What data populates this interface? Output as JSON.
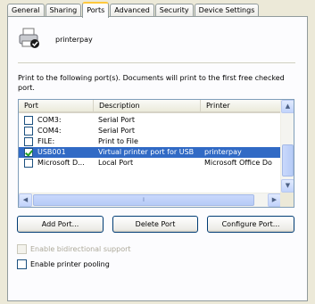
{
  "tabs": [
    {
      "label": "General",
      "active": false
    },
    {
      "label": "Sharing",
      "active": false
    },
    {
      "label": "Ports",
      "active": true
    },
    {
      "label": "Advanced",
      "active": false
    },
    {
      "label": "Security",
      "active": false
    },
    {
      "label": "Device Settings",
      "active": false
    }
  ],
  "printer": {
    "name": "printerpay"
  },
  "description": "Print to the following port(s). Documents will print to the first free checked port.",
  "ports": {
    "columns": [
      "Port",
      "Description",
      "Printer"
    ],
    "rows": [
      {
        "port": "COM3:",
        "description": "Serial Port",
        "printer": "",
        "checked": false,
        "selected": false
      },
      {
        "port": "COM4:",
        "description": "Serial Port",
        "printer": "",
        "checked": false,
        "selected": false
      },
      {
        "port": "FILE:",
        "description": "Print to File",
        "printer": "",
        "checked": false,
        "selected": false
      },
      {
        "port": "USB001",
        "description": "Virtual printer port for USB",
        "printer": "printerpay",
        "checked": true,
        "selected": true
      },
      {
        "port": "Microsoft D...",
        "description": "Local Port",
        "printer": "Microsoft Office Do",
        "checked": false,
        "selected": false
      }
    ]
  },
  "buttons": {
    "add_port": "Add Port...",
    "delete_port": "Delete Port",
    "configure_port": "Configure Port..."
  },
  "options": {
    "bidirectional": {
      "label": "Enable bidirectional support",
      "checked": false,
      "enabled": false
    },
    "pooling": {
      "label": "Enable printer pooling",
      "checked": false,
      "enabled": true
    }
  },
  "colors": {
    "selection": "#316ac5",
    "tab_highlight": "#ffc83c",
    "face": "#ece9d8"
  }
}
